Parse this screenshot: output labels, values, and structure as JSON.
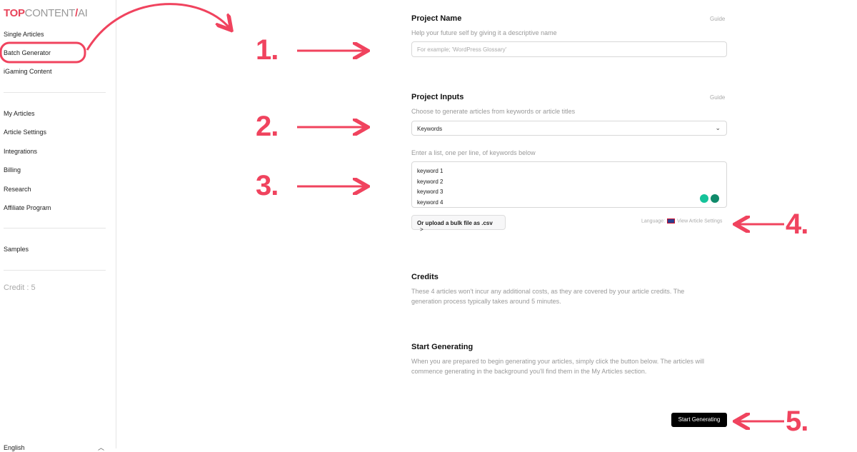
{
  "sidebar": {
    "logo": {
      "top": "TOP",
      "content": "CONTENT",
      "slash": "/",
      "ai": "AI"
    },
    "items": [
      "Single Articles",
      "Batch Generator",
      "iGaming Content",
      "My Articles",
      "Article Settings",
      "Integrations",
      "Billing",
      "Research",
      "Affiliate Program",
      "Samples"
    ],
    "credit": "Credit : 5",
    "language": "English"
  },
  "main": {
    "project_name": {
      "title": "Project Name",
      "guide": "Guide",
      "subtitle": "Help your future self by giving it a descriptive name",
      "placeholder": "For example; 'WordPress Glossary'"
    },
    "project_inputs": {
      "title": "Project Inputs",
      "guide": "Guide",
      "subtitle": "Choose to generate articles from keywords or article titles",
      "selected": "Keywords",
      "list_label": "Enter a list, one per line, of keywords below",
      "keywords": [
        "keyword 1",
        "keyword 2",
        "keyword 3",
        "keyword 4"
      ],
      "upload": "Or upload a bulk file as .csv",
      "language_label": "Language:",
      "view_settings": "View Article Settings"
    },
    "credits": {
      "title": "Credits",
      "text": "These 4 articles won't incur any additional costs, as they are covered by your article credits. The generation process typically takes around 5 minutes."
    },
    "start": {
      "title": "Start Generating",
      "text": "When you are prepared to begin generating your articles, simply click the button below. The articles will commence generating in the background you'll find them in the My Articles section.",
      "button": "Start Generating"
    }
  },
  "annotations": {
    "numbers": [
      "1.",
      "2.",
      "3.",
      "4.",
      "5."
    ],
    "color": "#f0435e"
  }
}
